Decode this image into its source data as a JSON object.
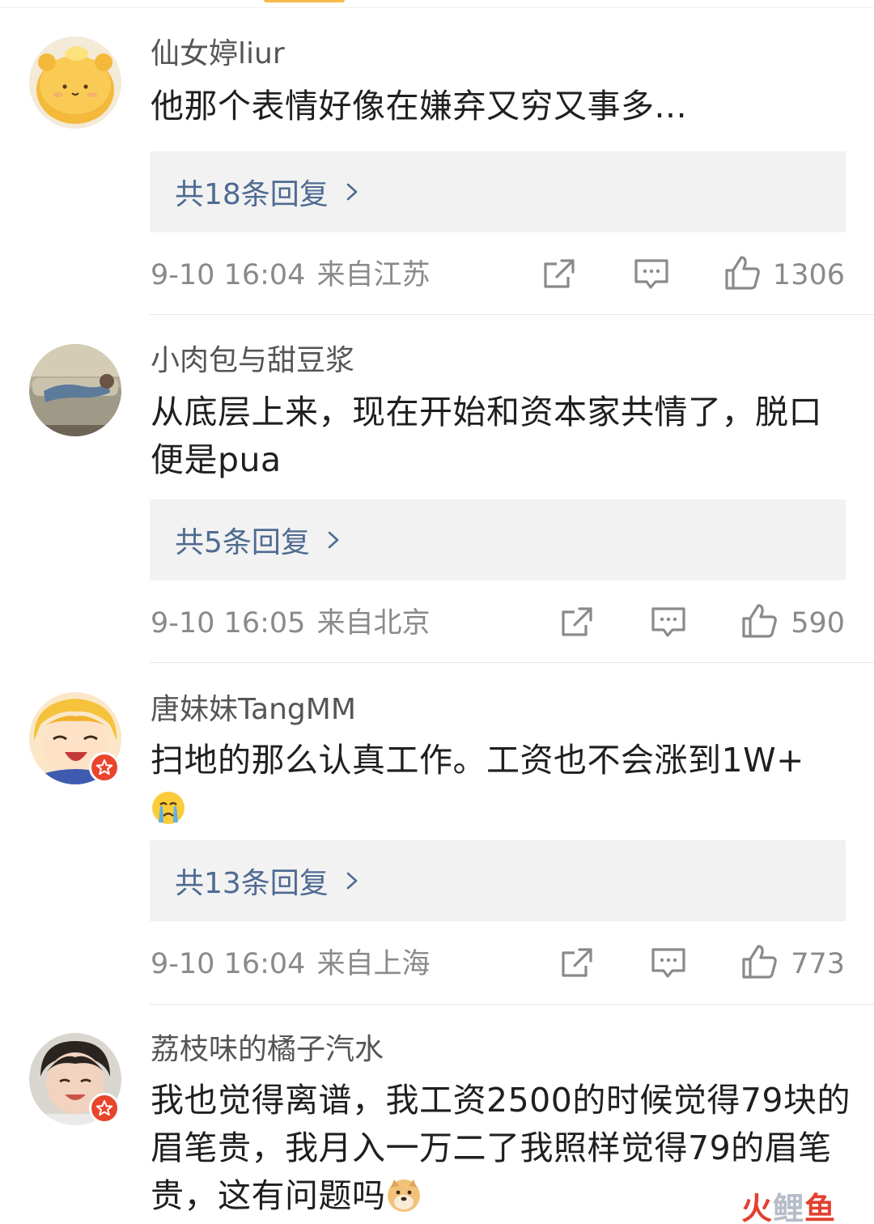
{
  "comments": [
    {
      "username": "仙女婷liur",
      "content": "他那个表情好像在嫌弃又穷又事多...",
      "reply_label": "共18条回复",
      "time": "9-10 16:04",
      "location": "来自江苏",
      "likes": "1306",
      "verified": false,
      "avatar": "yellow-bear-avatar"
    },
    {
      "username": "小肉包与甜豆浆",
      "content": "从底层上来，现在开始和资本家共情了，脱口便是pua",
      "reply_label": "共5条回复",
      "time": "9-10 16:05",
      "location": "来自北京",
      "likes": "590",
      "verified": false,
      "avatar": "sofa-photo-avatar"
    },
    {
      "username": "唐妹妹TangMM",
      "content": "扫地的那么认真工作。工资也不会涨到1W+",
      "content_emoji": "crying-face",
      "reply_label": "共13条回复",
      "time": "9-10 16:04",
      "location": "来自上海",
      "likes": "773",
      "verified": true,
      "avatar": "anime-girl-avatar"
    },
    {
      "username": "荔枝味的橘子汽水",
      "content": "我也觉得离谱，我工资2500的时候觉得79块的眉笔贵，我月入一万二了我照样觉得79的眉笔贵，这有问题吗",
      "content_emoji": "doge-face",
      "verified": true,
      "avatar": "child-photo-avatar"
    }
  ],
  "icons": {
    "share": "share-icon",
    "comment": "comment-icon",
    "like": "thumbs-up-icon",
    "chevron": "chevron-right-icon"
  },
  "colors": {
    "reply_link": "#4f6b92",
    "reply_bg": "#f2f2f2",
    "meta_text": "#8a8a8a",
    "verified_badge": "#e8452c",
    "top_tab_accent": "#f7b94a"
  },
  "watermark": {
    "part1": "火",
    "part2": "鲤",
    "part3": "鱼"
  }
}
